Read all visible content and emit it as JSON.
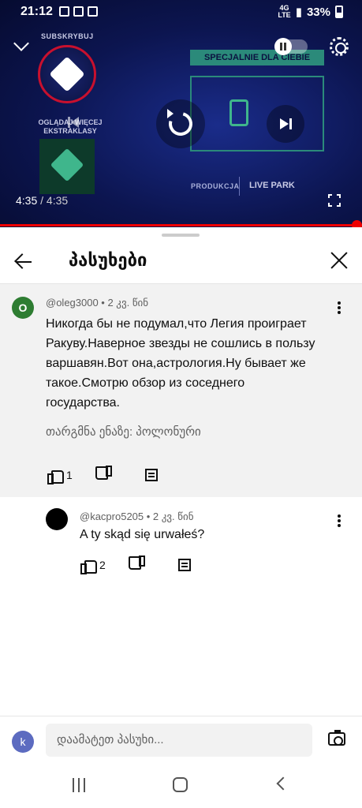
{
  "status_bar": {
    "time": "21:12",
    "network": "4G",
    "network_sub": "LTE",
    "battery": "33%"
  },
  "video": {
    "subscribe_text": "SUBSKRYBUJ",
    "watch_more_text": "OGLĄDAJ WIĘCEJ EKSTRAKLASY",
    "special_banner": "SPECJALNIE DLA CIEBIE",
    "production_label": "PRODUKCJA",
    "sponsor": "LIVE PARK",
    "current_time": "4:35",
    "separator": " / ",
    "duration": "4:35",
    "progress_fraction": 1.0,
    "progress_color": "#ee0000"
  },
  "panel": {
    "title": "პასუხები"
  },
  "main_comment": {
    "avatar_letter": "O",
    "avatar_color": "#2e7d32",
    "meta": "@oleg3000 • 2 კვ. წინ",
    "text": "Никогда бы не подумал,что Легия проиграет Ракуву.Наверное звезды не сошлись в пользу варшавян.Вот она,астрология.Ну бывает же такое.Смотрю обзор из соседнего государства.",
    "translate": "თარგმნა ენაზე: პოლონური",
    "likes": "1"
  },
  "reply_comment": {
    "avatar_color": "#000000",
    "meta": "@kacpro5205 • 2 კვ. წინ",
    "text": "A ty skąd się urwałeś?",
    "likes": "2"
  },
  "composer": {
    "avatar_letter": "k",
    "avatar_color": "#5c6bc0",
    "placeholder": "დაამატეთ პასუხი..."
  }
}
